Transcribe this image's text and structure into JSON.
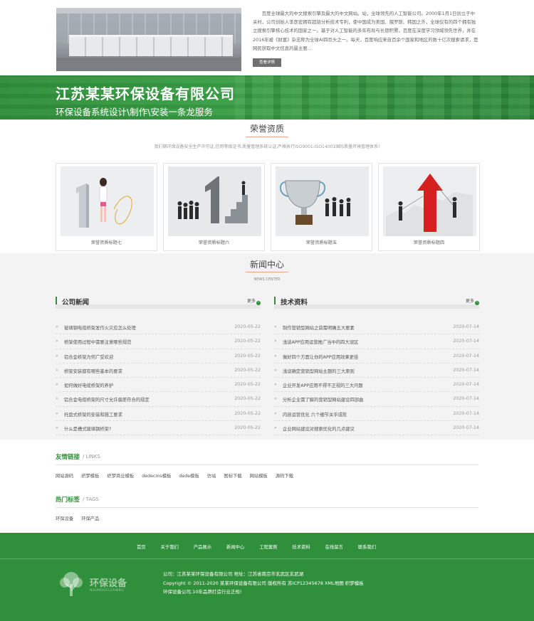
{
  "about": {
    "text": "百度全球最大的中文搜索引擎及最大的中文网站。站，全球领先的人工智能公司。2000年1月1日创立于中关村，公司创始人李彦宏拥有超链分析技术专利，使中国成为美国、俄罗斯、韩国之外，全球仅有的四个拥有独立搜索引擎核心技术的国家之一。基于对人工智能的多年布局与长期积累，百度在深度学习领域领先世界，并在2016年被《财富》杂志称为全球AI四巨头之一。每天，百度响应来自百余个国家和地区的数十亿次搜索请求，是网民获取中文信息的最主要...",
    "more_label": "查看详情"
  },
  "banner": {
    "title": "江苏某某环保设备有限公司",
    "subtitle": "环保设备系统设计\\制作\\安装一条龙服务"
  },
  "honors": {
    "title": "荣誉资质",
    "desc": "我们期环保设备安全生产许可证,信用等级证书,质量管理系统认证,严格执行ISO9001:ISO14001国际质量环境管理体系!",
    "items": [
      {
        "caption": "荣誉资质标题七"
      },
      {
        "caption": "荣誉资质标题六"
      },
      {
        "caption": "荣誉资质标题五"
      },
      {
        "caption": "荣誉资质标题四"
      }
    ]
  },
  "news": {
    "title": "新闻中心",
    "subtitle": "NEWS CENTER",
    "more_label": "更多",
    "company": {
      "title": "公司新闻",
      "items": [
        {
          "title": "玻璃钢电缆桥架发作火灾应怎么处理",
          "date": "2020-05-22"
        },
        {
          "title": "桥架使用过程中需要注意哪些规范",
          "date": "2020-05-22"
        },
        {
          "title": "铝合金桥架为何广受欢迎",
          "date": "2020-05-22"
        },
        {
          "title": "桥架安装都有哪些基本的要求",
          "date": "2020-05-22"
        },
        {
          "title": "如何做好电缆桥架的养护",
          "date": "2020-05-22"
        },
        {
          "title": "铝合金电缆桥架的尺寸允许偏差符合的规定",
          "date": "2020-05-22"
        },
        {
          "title": "托盘式桥架的安装和施工要求",
          "date": "2020-05-22"
        },
        {
          "title": "什么是槽式玻璃钢桥架?",
          "date": "2020-05-22"
        }
      ]
    },
    "tech": {
      "title": "技术资料",
      "items": [
        {
          "title": "制作营销型网站之前需明确五大要素",
          "date": "2020-07-14"
        },
        {
          "title": "浅谈APP应用运营推广当中的四大误区",
          "date": "2020-07-14"
        },
        {
          "title": "做好四个方面让你的APP应用效果更佳",
          "date": "2020-07-14"
        },
        {
          "title": "浅谈确定营销型网站主题的三大原则",
          "date": "2020-07-14"
        },
        {
          "title": "企业开发APP应用不得不正视的三大问题",
          "date": "2020-07-14"
        },
        {
          "title": "分析企业需了解的营销型网站建设四部曲",
          "date": "2020-07-14"
        },
        {
          "title": "内容运营优化 六个细节关乎成败",
          "date": "2020-07-14"
        },
        {
          "title": "企业网站建设对搜索优化的几点建议",
          "date": "2020-07-14"
        }
      ]
    }
  },
  "links": {
    "title": "友情链接",
    "en": "/ LINKS",
    "items": [
      "网站源码",
      "织梦模板",
      "织梦商业模板",
      "dedecms模板",
      "dede模板",
      "仿站",
      "图标下载",
      "网站模板",
      "源码下载"
    ]
  },
  "tags": {
    "title": "热门标签",
    "en": "/ TAGS",
    "items": [
      "环保设备",
      "环保产品"
    ]
  },
  "footer": {
    "nav": [
      "首页",
      "关于我们",
      "产品展示",
      "新闻中心",
      "工程案例",
      "技术资料",
      "在线留言",
      "联系我们"
    ],
    "logo_name": "环保设备",
    "logo_en": "NOUMOUCLEANING",
    "line1": "公司：江苏某某环保设备有限公司 地址：江苏省南京市玄武区玄武湖",
    "line2": "Copyright © 2011-2020 某某环保设备有限公司 版权所有 苏ICP12345678 XML地图 织梦模板",
    "line3": "环保设备公司,10年品牌打造行业正规!"
  },
  "colors": {
    "brand_green": "#2f8f3a",
    "accent_line": "#e7a88a",
    "button_gray": "#6f6f6f"
  }
}
